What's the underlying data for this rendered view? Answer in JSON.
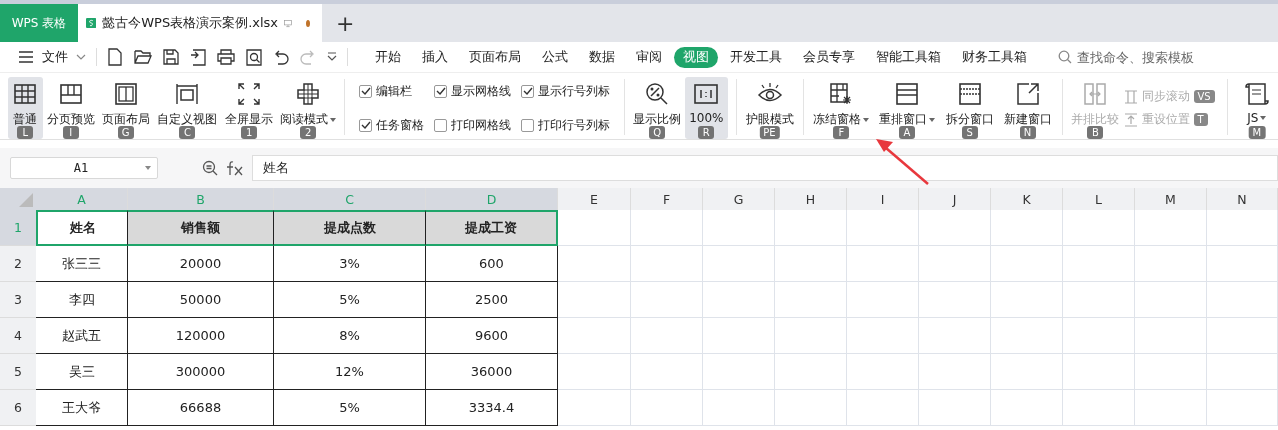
{
  "title_bar": {
    "app_tab": "WPS 表格",
    "doc_tab": {
      "title": "懿古今WPS表格演示案例.xlsx",
      "unsaved": true
    },
    "new_tab": "+"
  },
  "menu": {
    "file": "文件",
    "tabs": [
      {
        "label": "开始",
        "selected": false
      },
      {
        "label": "插入",
        "selected": false
      },
      {
        "label": "页面布局",
        "selected": false
      },
      {
        "label": "公式",
        "selected": false
      },
      {
        "label": "数据",
        "selected": false
      },
      {
        "label": "审阅",
        "selected": false
      },
      {
        "label": "视图",
        "selected": true
      },
      {
        "label": "开发工具",
        "selected": false
      },
      {
        "label": "会员专享",
        "selected": false
      },
      {
        "label": "智能工具箱",
        "selected": false
      },
      {
        "label": "财务工具箱",
        "selected": false
      }
    ],
    "search": {
      "placeholder": "查找命令、搜索模板"
    }
  },
  "ribbon": [
    {
      "kind": "big",
      "label": "普通",
      "key": "L",
      "selected": true,
      "dropdown": false,
      "disabled": false
    },
    {
      "kind": "big",
      "label": "分页预览",
      "key": "I",
      "selected": false,
      "dropdown": false,
      "disabled": false
    },
    {
      "kind": "big",
      "label": "页面布局",
      "key": "G",
      "selected": false,
      "dropdown": false,
      "disabled": false
    },
    {
      "kind": "big",
      "label": "自定义视图",
      "key": "C",
      "selected": false,
      "dropdown": false,
      "disabled": false
    },
    {
      "kind": "big",
      "label": "全屏显示",
      "key": "1",
      "selected": false,
      "dropdown": false,
      "disabled": false
    },
    {
      "kind": "big",
      "label": "阅读模式",
      "key": "2",
      "selected": false,
      "dropdown": true,
      "disabled": false
    },
    {
      "kind": "divider"
    },
    {
      "kind": "checks",
      "items": [
        {
          "label": "编辑栏",
          "checked": true
        },
        {
          "label": "任务窗格",
          "checked": true
        },
        {
          "label": "显示网格线",
          "checked": true
        },
        {
          "label": "打印网格线",
          "checked": false
        },
        {
          "label": "显示行号列标",
          "checked": true
        },
        {
          "label": "打印行号列标",
          "checked": false
        }
      ]
    },
    {
      "kind": "divider"
    },
    {
      "kind": "big",
      "label": "显示比例",
      "key": "Q",
      "selected": false,
      "dropdown": false,
      "disabled": false
    },
    {
      "kind": "big",
      "label": "100%",
      "key": "R",
      "selected": true,
      "dropdown": false,
      "disabled": false
    },
    {
      "kind": "divider"
    },
    {
      "kind": "big",
      "label": "护眼模式",
      "key": "PE",
      "selected": false,
      "dropdown": false,
      "disabled": false
    },
    {
      "kind": "divider"
    },
    {
      "kind": "big",
      "label": "冻结窗格",
      "key": "F",
      "selected": false,
      "dropdown": true,
      "disabled": false
    },
    {
      "kind": "big",
      "label": "重排窗口",
      "key": "A",
      "selected": false,
      "dropdown": true,
      "disabled": false
    },
    {
      "kind": "big",
      "label": "拆分窗口",
      "key": "S",
      "selected": false,
      "dropdown": false,
      "disabled": false
    },
    {
      "kind": "big",
      "label": "新建窗口",
      "key": "N",
      "selected": false,
      "dropdown": false,
      "disabled": false
    },
    {
      "kind": "divider"
    },
    {
      "kind": "big",
      "label": "并排比较",
      "key": "B",
      "selected": false,
      "dropdown": false,
      "disabled": true
    },
    {
      "kind": "smalls",
      "items": [
        {
          "label": "同步滚动",
          "key": "VS",
          "disabled": true
        },
        {
          "label": "重设位置",
          "key": "T",
          "disabled": true
        }
      ]
    },
    {
      "kind": "divider"
    },
    {
      "kind": "big",
      "label": "JS",
      "key": "M",
      "selected": false,
      "dropdown": true,
      "disabled": false
    }
  ],
  "formula_bar": {
    "name_box": "A1",
    "formula": "姓名"
  },
  "sheet": {
    "columns": [
      {
        "label": "A",
        "selected": true
      },
      {
        "label": "B",
        "selected": true
      },
      {
        "label": "C",
        "selected": true
      },
      {
        "label": "D",
        "selected": true
      },
      {
        "label": "E",
        "selected": false
      },
      {
        "label": "F",
        "selected": false
      },
      {
        "label": "G",
        "selected": false
      },
      {
        "label": "H",
        "selected": false
      },
      {
        "label": "I",
        "selected": false
      },
      {
        "label": "J",
        "selected": false
      },
      {
        "label": "K",
        "selected": false
      },
      {
        "label": "L",
        "selected": false
      },
      {
        "label": "M",
        "selected": false
      },
      {
        "label": "N",
        "selected": false
      }
    ],
    "rows": [
      {
        "number": "1",
        "selected": true,
        "cells": [
          "姓名",
          "销售额",
          "提成点数",
          "提成工资"
        ]
      },
      {
        "number": "2",
        "selected": false,
        "cells": [
          "张三三",
          "20000",
          "3%",
          "600"
        ]
      },
      {
        "number": "3",
        "selected": false,
        "cells": [
          "李四",
          "50000",
          "5%",
          "2500"
        ]
      },
      {
        "number": "4",
        "selected": false,
        "cells": [
          "赵武五",
          "120000",
          "8%",
          "9600"
        ]
      },
      {
        "number": "5",
        "selected": false,
        "cells": [
          "吴三",
          "300000",
          "12%",
          "36000"
        ]
      },
      {
        "number": "6",
        "selected": false,
        "cells": [
          "王大爷",
          "66688",
          "5%",
          "3334.4"
        ]
      }
    ]
  }
}
